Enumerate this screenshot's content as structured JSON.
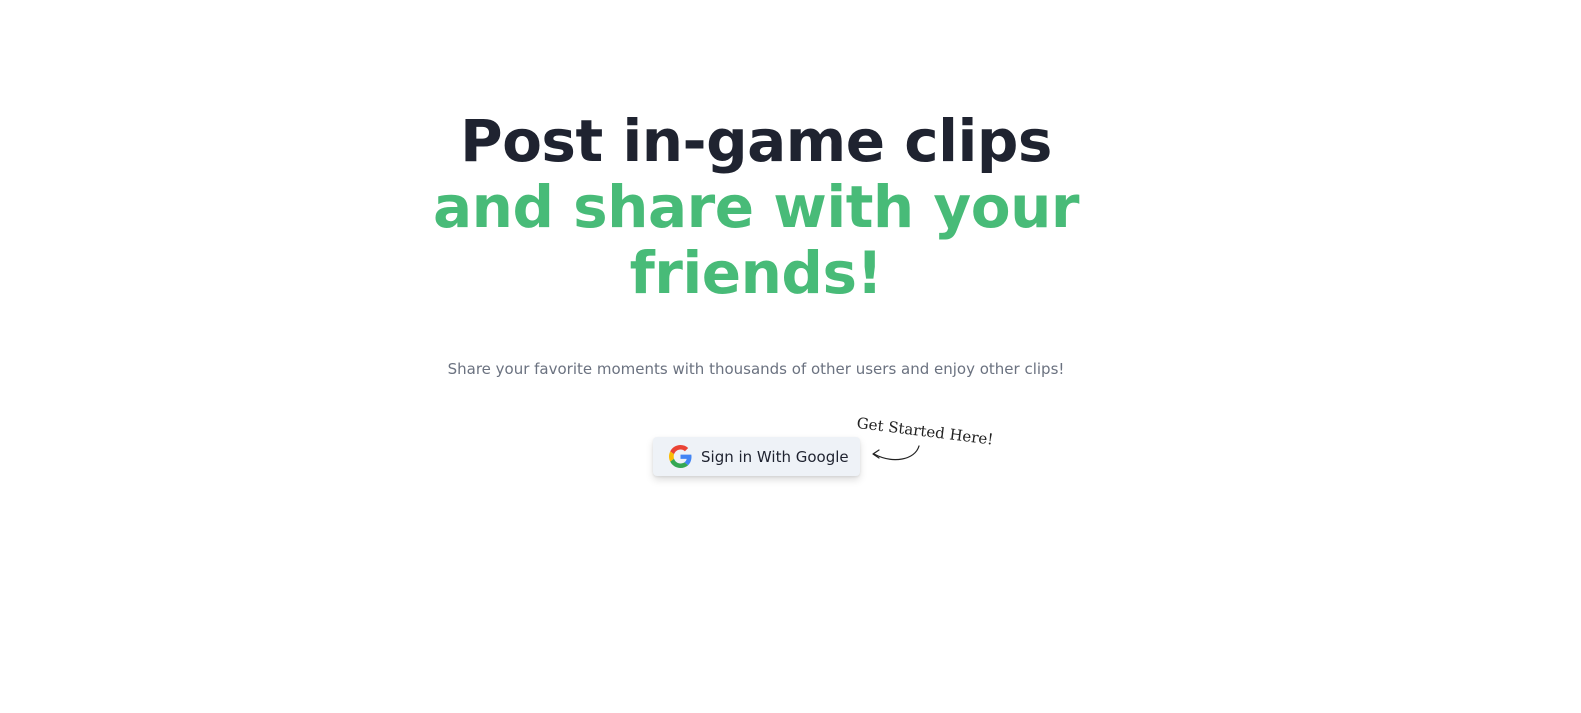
{
  "hero": {
    "headline_line1": "Post in-game clips",
    "headline_line2": "and share with your",
    "headline_line3": "friends!",
    "subtitle": "Share your favorite moments with thousands of other users and enjoy other clips!",
    "accent_color": "#48bb78",
    "text_color": "#1f2330"
  },
  "signin": {
    "button_label": "Sign in With Google",
    "icon": "google-g-icon",
    "annotation": "Get Started Here!",
    "annotation_icon": "curved-arrow-icon"
  }
}
